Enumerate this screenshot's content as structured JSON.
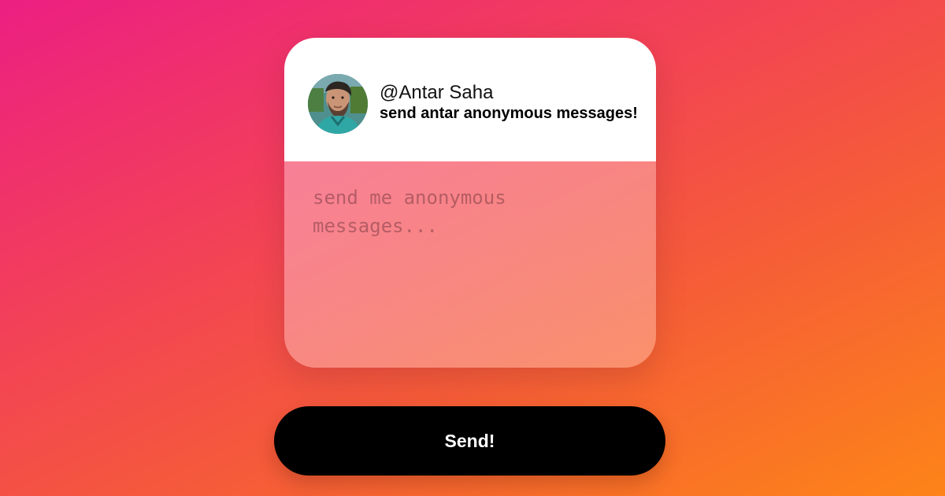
{
  "profile": {
    "username": "@Antar Saha",
    "prompt": "send antar anonymous messages!"
  },
  "message": {
    "placeholder": "send me anonymous messages...",
    "value": ""
  },
  "send_button": {
    "label": "Send!"
  },
  "colors": {
    "background_start": "#ec1f82",
    "background_end": "#fd8418",
    "card_header": "#ffffff",
    "button_background": "#000000",
    "button_text": "#ffffff"
  }
}
